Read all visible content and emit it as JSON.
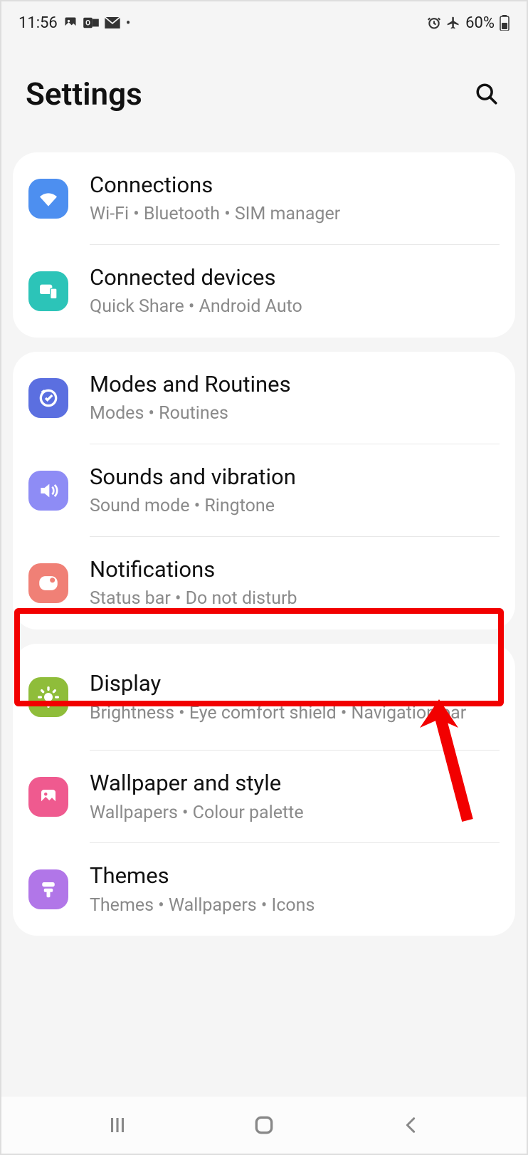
{
  "status": {
    "time": "11:56",
    "battery": "60%"
  },
  "header": {
    "title": "Settings"
  },
  "groups": [
    {
      "items": [
        {
          "title": "Connections",
          "sub": "Wi-Fi  •  Bluetooth  •  SIM manager",
          "icon": "wifi",
          "color": "#4d8ff0"
        },
        {
          "title": "Connected devices",
          "sub": "Quick Share  •  Android Auto",
          "icon": "devices",
          "color": "#2cc4b8"
        }
      ]
    },
    {
      "items": [
        {
          "title": "Modes and Routines",
          "sub": "Modes  •  Routines",
          "icon": "routines",
          "color": "#5b6fe0"
        },
        {
          "title": "Sounds and vibration",
          "sub": "Sound mode  •  Ringtone",
          "icon": "sound",
          "color": "#8e8cf5"
        },
        {
          "title": "Notifications",
          "sub": "Status bar  •  Do not disturb",
          "icon": "notifications",
          "color": "#f08076"
        }
      ]
    },
    {
      "items": [
        {
          "title": "Display",
          "sub": "Brightness  •  Eye comfort shield  •  Navigation bar",
          "icon": "display",
          "color": "#8fbd3a"
        },
        {
          "title": "Wallpaper and style",
          "sub": "Wallpapers  •  Colour palette",
          "icon": "wallpaper",
          "color": "#ef5a8f"
        },
        {
          "title": "Themes",
          "sub": "Themes  •  Wallpapers  •  Icons",
          "icon": "themes",
          "color": "#b176e8"
        }
      ]
    }
  ]
}
